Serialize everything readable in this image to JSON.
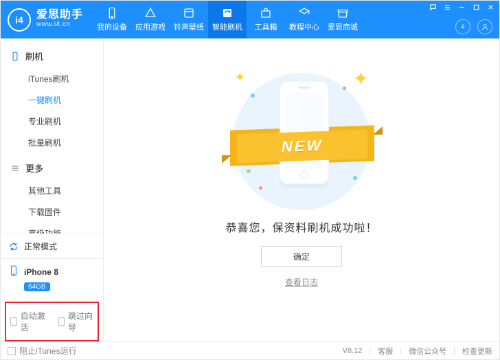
{
  "brand": {
    "logo_text": "i4",
    "name": "爱思助手",
    "subtitle": "www.i4.cn"
  },
  "tabs": [
    {
      "key": "devices",
      "label": "我的设备"
    },
    {
      "key": "apps",
      "label": "应用游戏"
    },
    {
      "key": "rings",
      "label": "铃声壁纸"
    },
    {
      "key": "flash",
      "label": "智能刷机"
    },
    {
      "key": "tools",
      "label": "工具箱"
    },
    {
      "key": "tutorial",
      "label": "教程中心"
    },
    {
      "key": "store",
      "label": "爱思商城"
    }
  ],
  "active_tab": "flash",
  "side": {
    "cats": [
      {
        "key": "flash",
        "label": "刷机",
        "icon": "device-icon",
        "items": [
          {
            "key": "itunes",
            "label": "iTunes刷机"
          },
          {
            "key": "onekey",
            "label": "一键刷机",
            "active": true
          },
          {
            "key": "pro",
            "label": "专业刷机"
          },
          {
            "key": "batch",
            "label": "批量刷机"
          }
        ]
      },
      {
        "key": "more",
        "label": "更多",
        "icon": "more-icon",
        "items": [
          {
            "key": "other",
            "label": "其他工具"
          },
          {
            "key": "fw",
            "label": "下载固件"
          },
          {
            "key": "adv",
            "label": "高级功能"
          }
        ]
      }
    ],
    "mode": {
      "label": "正常模式",
      "icon": "refresh-icon"
    },
    "device": {
      "name": "iPhone 8",
      "storage": "64GB",
      "icon": "phone-icon"
    },
    "opts": {
      "auto_activate": "自动激活",
      "skip_guide": "跳过向导"
    }
  },
  "main": {
    "ribbon": "NEW",
    "headline": "恭喜您，保资料刷机成功啦！",
    "ok": "确定",
    "log": "查看日志"
  },
  "footer": {
    "block_itunes": "阻止iTunes运行",
    "version": "V8.12",
    "links": [
      "客服",
      "微信公众号",
      "检查更新"
    ]
  }
}
